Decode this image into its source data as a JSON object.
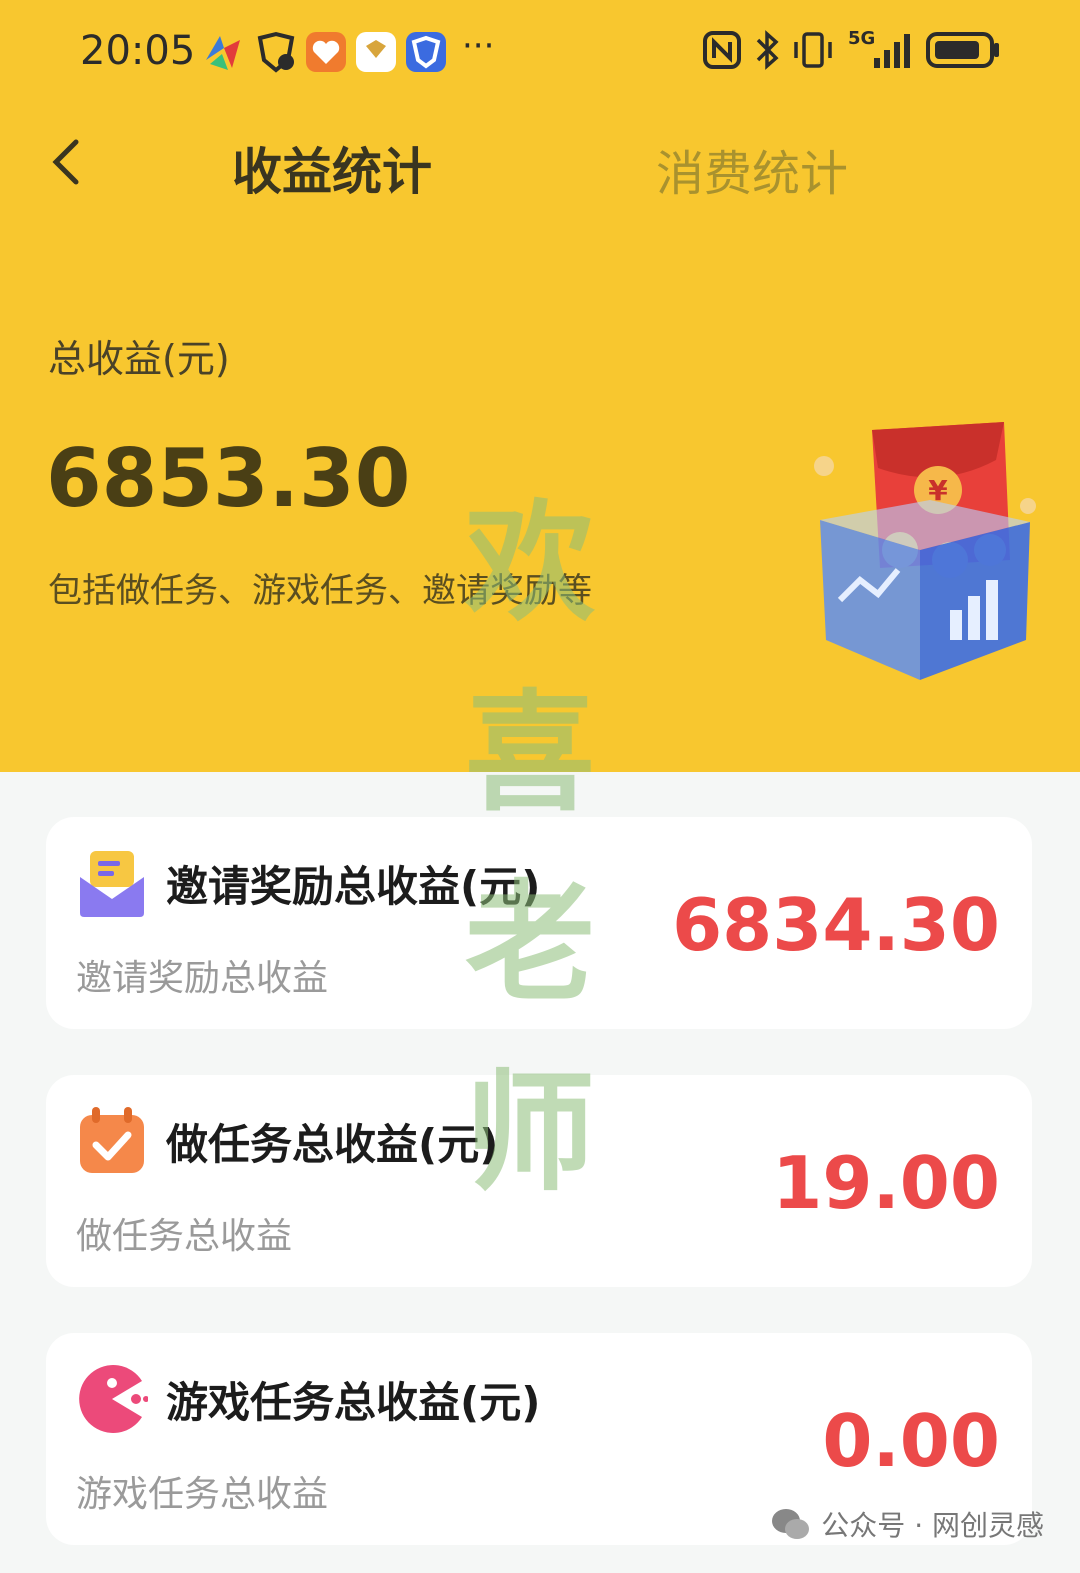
{
  "status_bar": {
    "time": "20:05",
    "network": "5G",
    "icons": [
      "app-icon",
      "shield-check-icon",
      "heart-app-icon",
      "honor-app-icon",
      "shield-app-icon",
      "more-icon",
      "nfc-icon",
      "bluetooth-icon",
      "vibrate-icon",
      "signal-icon",
      "battery-icon"
    ],
    "more": "···"
  },
  "header": {
    "back_icon": "chevron-left-icon",
    "tabs": [
      {
        "label": "收益统计",
        "active": true
      },
      {
        "label": "消费统计",
        "active": false
      }
    ]
  },
  "summary": {
    "label": "总收益(元)",
    "value": "6853.30",
    "description": "包括做任务、游戏任务、邀请奖励等",
    "illustration": "red-envelope-box-icon"
  },
  "cards": [
    {
      "icon": "envelope-icon",
      "title": "邀请奖励总收益(元)",
      "subtitle": "邀请奖励总收益",
      "amount": "6834.30"
    },
    {
      "icon": "calendar-check-icon",
      "title": "做任务总收益(元)",
      "subtitle": "做任务总收益",
      "amount": "19.00"
    },
    {
      "icon": "game-pacman-icon",
      "title": "游戏任务总收益(元)",
      "subtitle": "游戏任务总收益",
      "amount": "0.00"
    }
  ],
  "watermark": {
    "chars": [
      "欢",
      "喜",
      "老",
      "师"
    ]
  },
  "footer": {
    "text": "公众号 · 网创灵感",
    "icon": "wechat-icon"
  },
  "colors": {
    "header_bg": "#f8c72f",
    "amount": "#ec4a4a",
    "page_bg": "#f5f7f6"
  }
}
